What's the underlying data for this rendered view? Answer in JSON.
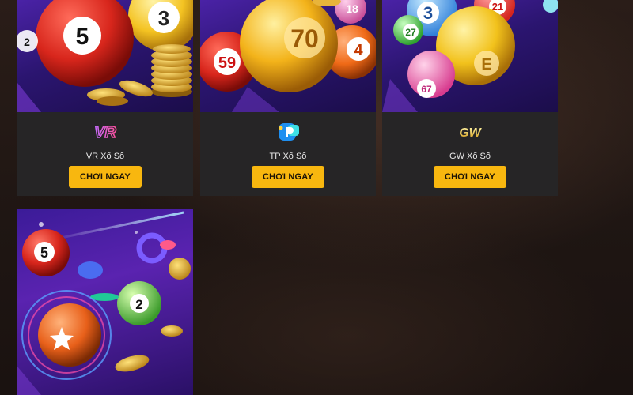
{
  "cards": [
    {
      "title": "VR Xổ Số",
      "button": "CHƠI NGAY",
      "logo": "vr-logo-icon"
    },
    {
      "title": "TP Xổ Số",
      "button": "CHƠI NGAY",
      "logo": "tp-logo-icon"
    },
    {
      "title": "GW Xổ Số",
      "button": "CHƠI NGAY",
      "logo": "gw-logo-icon"
    }
  ],
  "art_labels": {
    "card0": [
      "5",
      "3",
      "2"
    ],
    "card1": [
      "70",
      "59",
      "4",
      "18"
    ],
    "card2": [
      "3",
      "27",
      "21",
      "67",
      "E"
    ],
    "card3": [
      "5",
      "2"
    ]
  },
  "logo_text": {
    "vr": "VR",
    "gw": "GW"
  },
  "colors": {
    "button": "#f8b70f",
    "card_bg": "#262526",
    "page_bg": "#1f1613"
  }
}
